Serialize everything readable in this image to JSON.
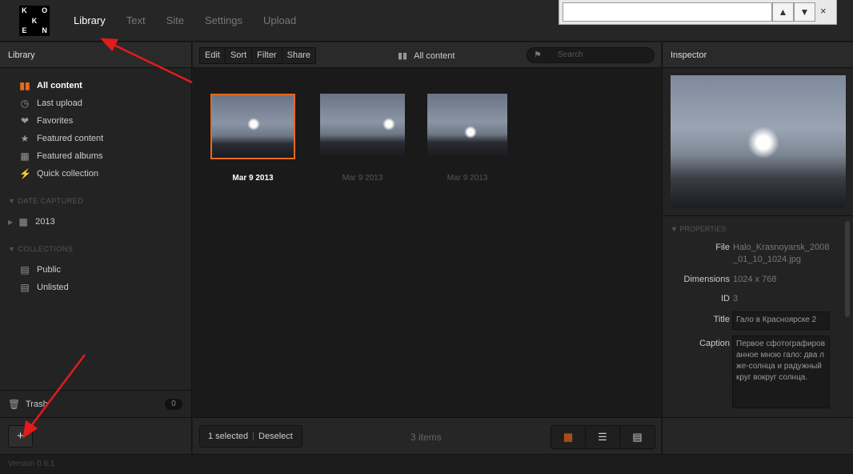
{
  "logo": {
    "letters": [
      "K",
      "",
      "O",
      "",
      "K",
      "",
      "E",
      "",
      "N"
    ]
  },
  "nav": {
    "items": [
      "Library",
      "Text",
      "Site",
      "Settings",
      "Upload"
    ],
    "active": "Library"
  },
  "findbar": {
    "value": "",
    "up": "^",
    "down": "v",
    "close": "×"
  },
  "left": {
    "title": "Library",
    "items": [
      {
        "label": "All content",
        "icon": "library-icon",
        "active": true
      },
      {
        "label": "Last upload",
        "icon": "clock-icon"
      },
      {
        "label": "Favorites",
        "icon": "heart-icon"
      },
      {
        "label": "Featured content",
        "icon": "star-icon"
      },
      {
        "label": "Featured albums",
        "icon": "featured-album-icon"
      },
      {
        "label": "Quick collection",
        "icon": "bolt-icon"
      }
    ],
    "date_section": "DATE CAPTURED",
    "date_item": "2013",
    "collections_section": "COLLECTIONS",
    "collections": [
      "Public",
      "Unlisted"
    ],
    "trash": "Trash",
    "trash_count": "0",
    "add_label": "+"
  },
  "toolbar": {
    "buttons": [
      "Edit",
      "Sort",
      "Filter",
      "Share"
    ],
    "context": "All content",
    "search_placeholder": "Search"
  },
  "thumbs": [
    {
      "date": "Mar 9 2013",
      "selected": true
    },
    {
      "date": "Mar 9 2013",
      "selected": false
    },
    {
      "date": "Mar 9 2013",
      "selected": false
    }
  ],
  "footer": {
    "selected": "1 selected",
    "deselect": "Deselect",
    "items": "3 items"
  },
  "inspector": {
    "title": "Inspector",
    "properties_header": "PROPERTIES",
    "file_label": "File",
    "file_value": "Halo_Krasnoyarsk_2008_01_10_1024.jpg",
    "dim_label": "Dimensions",
    "dim_value": "1024 x 768",
    "id_label": "ID",
    "id_value": "3",
    "title_label": "Title",
    "title_value": "Гало в Красноярске 2",
    "caption_label": "Caption",
    "caption_value": "Первое сфотографированное мною гало: два лже-солнца и радужный круг вокруг солнца."
  },
  "version": "Version 0.6.1",
  "accent": "#e76a1c"
}
